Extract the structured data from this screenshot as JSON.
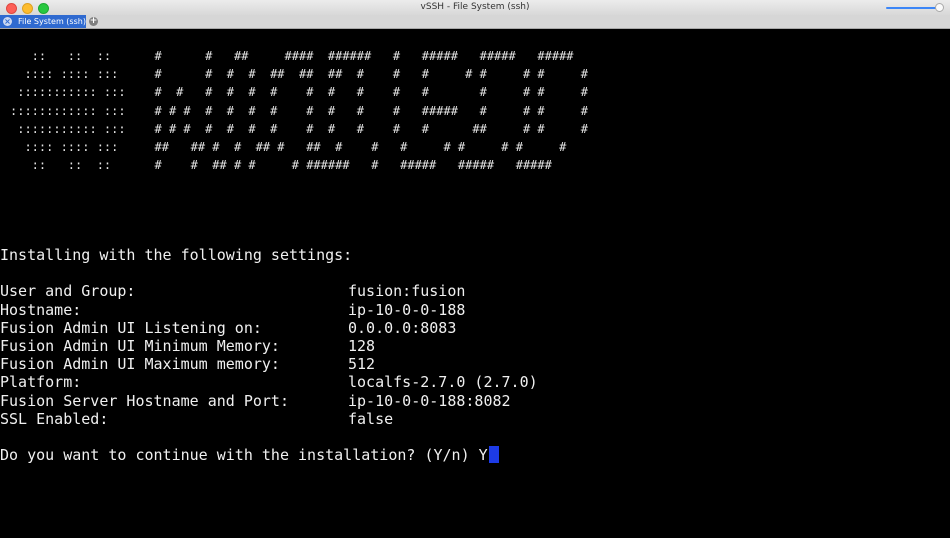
{
  "window": {
    "title": "vSSH - File System (ssh)"
  },
  "tabs": [
    {
      "label": "File System (ssh)"
    }
  ],
  "icons": {
    "close": "close-icon",
    "add": "add-tab-icon",
    "slider": "zoom-slider"
  },
  "terminal": {
    "banner": [
      "   ::   ::  ::      #      #   ##     ####  ######   #   #####   #####   #####",
      "  :::: :::: :::     #      #  #  #  ##  ##  ##  #    #   #     # #     # #     #",
      " ::::::::::: :::    #  #   #  #  #  #    #  #   #    #   #       #     # #     #",
      ":::::::::::: :::    # # #  #  #  #  #    #  #   #    #   #####   #     # #     #",
      " ::::::::::: :::    # # #  #  #  #  #    #  #   #    #   #      ##     # #     #",
      "  :::: :::: :::     ##   ## #  #  ## #   ##  #    #   #     # #     # #     #",
      "   ::   ::  ::      #    #  ## # #     # ######   #   #####   #####   #####"
    ],
    "heading": "Installing with the following settings:",
    "settings": [
      {
        "label": "User and Group:",
        "value": "fusion:fusion"
      },
      {
        "label": "Hostname:",
        "value": "ip-10-0-0-188"
      },
      {
        "label": "Fusion Admin UI Listening on:",
        "value": "0.0.0.0:8083"
      },
      {
        "label": "Fusion Admin UI Minimum Memory:",
        "value": "128"
      },
      {
        "label": "Fusion Admin UI Maximum memory:",
        "value": "512"
      },
      {
        "label": "Platform:",
        "value": "localfs-2.7.0 (2.7.0)"
      },
      {
        "label": "Fusion Server Hostname and Port:",
        "value": "ip-10-0-0-188:8082"
      },
      {
        "label": "SSL Enabled:",
        "value": "false"
      }
    ],
    "prompt": "Do you want to continue with the installation? (Y/n) Y",
    "cursor_color": "#1d3be6"
  }
}
